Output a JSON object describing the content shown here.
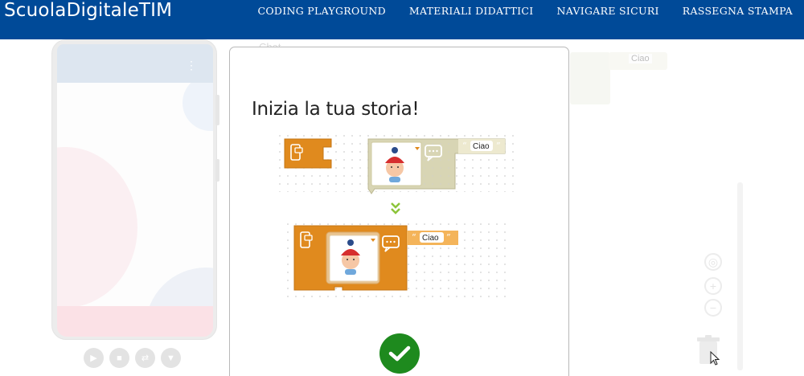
{
  "header": {
    "logo": "ScuolaDigitaleTIM",
    "nav": [
      "CODING PLAYGROUND",
      "MATERIALI DIDATTICI",
      "NAVIGARE SICURI",
      "RASSEGNA STAMPA"
    ]
  },
  "workspace": {
    "label": "Chat",
    "block_text": "Ciao"
  },
  "modal": {
    "title": "Inizia la tua storia!",
    "bubble_text_top": "Ciao",
    "bubble_text_bottom": "Ciao"
  },
  "colors": {
    "header_bg": "#004a98",
    "block_orange": "#e08a1e",
    "confirm_green": "#1e8a1e"
  },
  "icons": {
    "confirm": "check-icon",
    "merge": "double-chevron-down-icon"
  }
}
